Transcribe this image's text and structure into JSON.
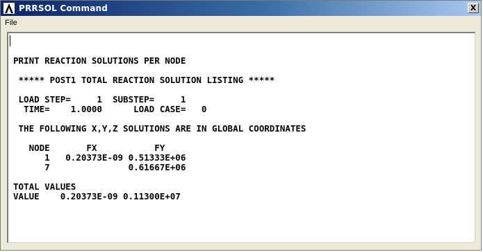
{
  "window": {
    "title": "PRRSOL  Command",
    "close_label": "X"
  },
  "menubar": {
    "file_label": "File"
  },
  "output": {
    "lines": [
      "PRINT REACTION SOLUTIONS PER NODE",
      "",
      " ***** POST1 TOTAL REACTION SOLUTION LISTING *****",
      "",
      " LOAD STEP=     1  SUBSTEP=     1",
      "  TIME=    1.0000      LOAD CASE=   0",
      "",
      " THE FOLLOWING X,Y,Z SOLUTIONS ARE IN GLOBAL COORDINATES",
      "",
      "   NODE       FX           FY",
      "      1   0.20373E-09 0.51333E+06",
      "      7               0.61667E+06",
      "",
      "TOTAL VALUES",
      "VALUE    0.20373E-09 0.11300E+07"
    ]
  }
}
